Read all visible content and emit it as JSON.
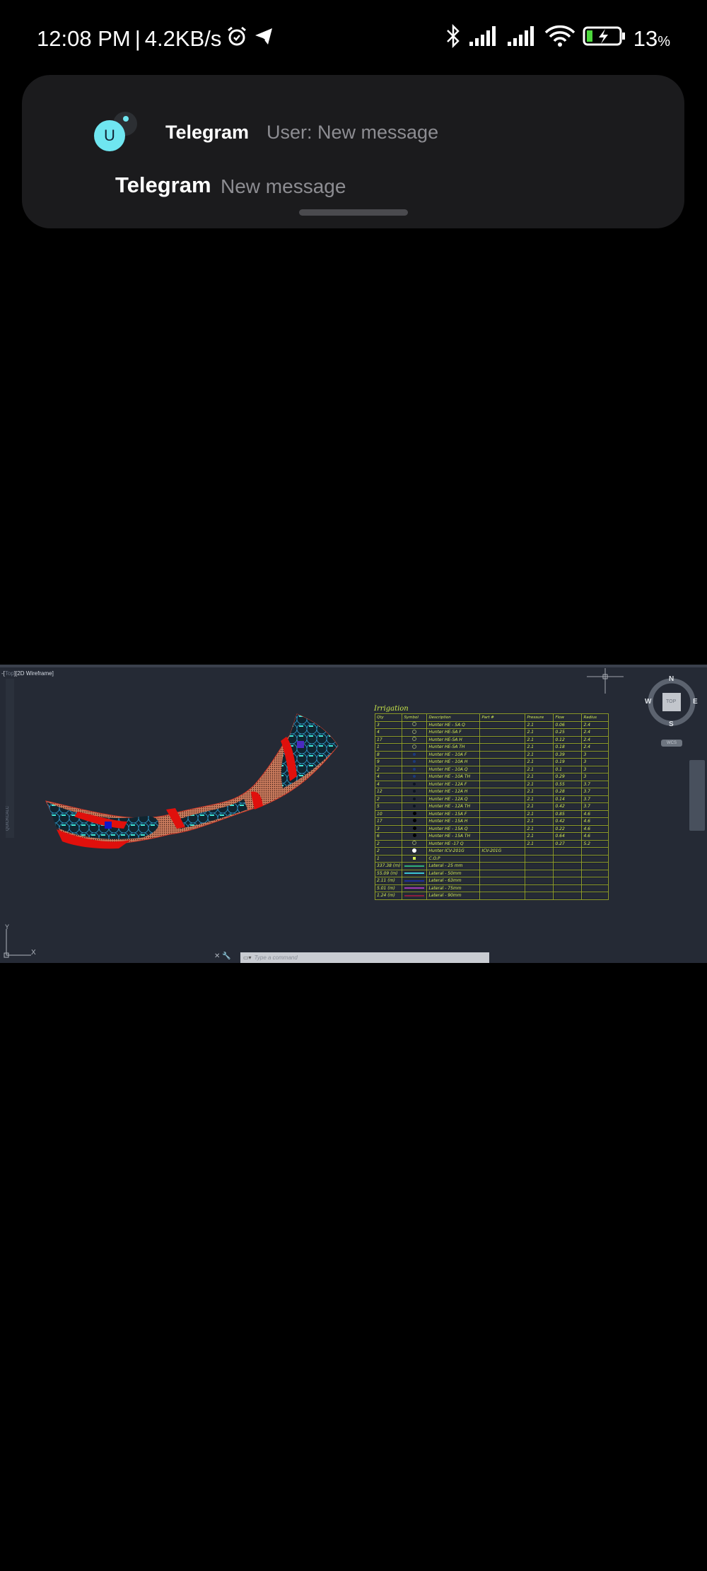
{
  "status_bar": {
    "time": "12:08 PM",
    "separator": "|",
    "net_speed": "4.2KB/s",
    "left_icons": [
      "alarm-icon",
      "telegram-icon"
    ],
    "right_icons": [
      "bluetooth-icon",
      "signal-icon",
      "signal-icon",
      "wifi-icon",
      "battery-charging-icon"
    ],
    "battery": "13",
    "battery_unit": "%"
  },
  "notification": {
    "avatar_letter": "U",
    "app_name": "Telegram",
    "title": "User: New message",
    "sender": "Telegram",
    "message": "New message"
  },
  "cad": {
    "viewport_label_prefix": "-[",
    "viewport_view": "Top",
    "viewport_style": "][2D Wireframe]",
    "quickcalc_label": "QUICKCALC",
    "viewcube": {
      "n": "N",
      "s": "S",
      "e": "E",
      "w": "W",
      "face": "TOP",
      "wcs": "WCS"
    },
    "ucs_y": "Y",
    "ucs_x": "X",
    "command_placeholder": "Type a command",
    "colors": {
      "background": "#252a35",
      "table_text": "#d4ec54",
      "table_grid": "#8e9b28",
      "red": "#e0100c",
      "cyan": "#33e0d6"
    },
    "table": {
      "title": "Irrigation",
      "headers": [
        "Qty",
        "Symbol",
        "Description",
        "Part #",
        "Pressure",
        "Flow",
        "Radius"
      ],
      "rows": [
        {
          "qty": "3",
          "symbol": "ring-icon",
          "desc": "Hunter HE - 5A Q",
          "part": "",
          "pressure": "2.1",
          "flow": "0.06",
          "radius": "2.4"
        },
        {
          "qty": "4",
          "symbol": "ring-icon",
          "desc": "Hunter HE-5A F",
          "part": "",
          "pressure": "2.1",
          "flow": "0.25",
          "radius": "2.4"
        },
        {
          "qty": "17",
          "symbol": "ring-icon",
          "desc": "Hunter HE-5A H",
          "part": "",
          "pressure": "2.1",
          "flow": "0.12",
          "radius": "2.4"
        },
        {
          "qty": "1",
          "symbol": "ring-icon",
          "desc": "Hunter HE-5A TH",
          "part": "",
          "pressure": "2.1",
          "flow": "0.18",
          "radius": "2.4"
        },
        {
          "qty": "8",
          "symbol": "blue-dot-icon",
          "desc": "Hunter HE - 10A F",
          "part": "",
          "pressure": "2.1",
          "flow": "0.39",
          "radius": "3"
        },
        {
          "qty": "9",
          "symbol": "blue-dot-icon",
          "desc": "Hunter HE - 10A H",
          "part": "",
          "pressure": "2.1",
          "flow": "0.19",
          "radius": "3"
        },
        {
          "qty": "2",
          "symbol": "blue-dot-icon",
          "desc": "Hunter HE - 10A Q",
          "part": "",
          "pressure": "2.1",
          "flow": "0.1",
          "radius": "3"
        },
        {
          "qty": "4",
          "symbol": "blue-dot-icon",
          "desc": "Hunter HE - 10A TH",
          "part": "",
          "pressure": "2.1",
          "flow": "0.29",
          "radius": "3"
        },
        {
          "qty": "4",
          "symbol": "dark-dot-icon",
          "desc": "Hunter HE - 12A F",
          "part": "",
          "pressure": "2.1",
          "flow": "0.55",
          "radius": "3.7"
        },
        {
          "qty": "12",
          "symbol": "dark-dot-icon",
          "desc": "Hunter HE - 12A H",
          "part": "",
          "pressure": "2.1",
          "flow": "0.28",
          "radius": "3.7"
        },
        {
          "qty": "2",
          "symbol": "dark-dot-icon",
          "desc": "Hunter HE - 12A Q",
          "part": "",
          "pressure": "2.1",
          "flow": "0.14",
          "radius": "3.7"
        },
        {
          "qty": "5",
          "symbol": "dark-dot-icon",
          "desc": "Hunter HE - 12A TH",
          "part": "",
          "pressure": "2.1",
          "flow": "0.42",
          "radius": "3.7"
        },
        {
          "qty": "10",
          "symbol": "black-dot-icon",
          "desc": "Hunter HE - 15A F",
          "part": "",
          "pressure": "2.1",
          "flow": "0.85",
          "radius": "4.6"
        },
        {
          "qty": "17",
          "symbol": "black-dot-icon",
          "desc": "Hunter HE - 15A H",
          "part": "",
          "pressure": "2.1",
          "flow": "0.42",
          "radius": "4.6"
        },
        {
          "qty": "3",
          "symbol": "black-dot-icon",
          "desc": "Hunter HE - 15A Q",
          "part": "",
          "pressure": "2.1",
          "flow": "0.22",
          "radius": "4.6"
        },
        {
          "qty": "6",
          "symbol": "black-dot-icon",
          "desc": "Hunter HE - 15A TH",
          "part": "",
          "pressure": "2.1",
          "flow": "0.64",
          "radius": "4.6"
        },
        {
          "qty": "2",
          "symbol": "ring-icon",
          "desc": "Hunter HE -17 Q",
          "part": "",
          "pressure": "2.1",
          "flow": "0.27",
          "radius": "5.2"
        },
        {
          "qty": "2",
          "symbol": "valve-icon",
          "desc": "Hunter ICV-201G",
          "part": "ICV-201G",
          "pressure": "",
          "flow": "",
          "radius": ""
        },
        {
          "qty": "1",
          "symbol": "cop-square-icon",
          "desc": "C.O.P",
          "part": "",
          "pressure": "",
          "flow": "",
          "radius": ""
        },
        {
          "qty": "337.38 (m)",
          "symbol": "lateral-green-line",
          "desc": "Lateral - 25 mm",
          "part": "",
          "pressure": "",
          "flow": "",
          "radius": "",
          "color": "#2fae7a"
        },
        {
          "qty": "55.09 (m)",
          "symbol": "lateral-cyan-line",
          "desc": "Lateral - 50mm",
          "part": "",
          "pressure": "",
          "flow": "",
          "radius": "",
          "color": "#3bc4d4"
        },
        {
          "qty": "2.11 (m)",
          "symbol": "lateral-blue-line",
          "desc": "Lateral - 63mm",
          "part": "",
          "pressure": "",
          "flow": "",
          "radius": "",
          "color": "#1f2f9a"
        },
        {
          "qty": "5.01 (m)",
          "symbol": "lateral-purple-line",
          "desc": "Lateral - 75mm",
          "part": "",
          "pressure": "",
          "flow": "",
          "radius": "",
          "color": "#a03ab4"
        },
        {
          "qty": "1.24 (m)",
          "symbol": "lateral-maroon-line",
          "desc": "Lateral - 90mm",
          "part": "",
          "pressure": "",
          "flow": "",
          "radius": "",
          "color": "#8e1f3c"
        }
      ]
    }
  }
}
